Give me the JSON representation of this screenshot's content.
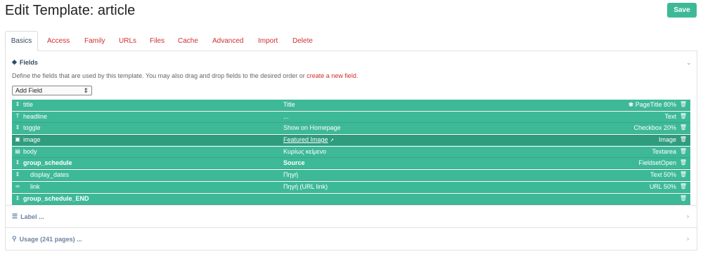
{
  "page_title": "Edit Template: article",
  "save_label": "Save",
  "tabs": [
    "Basics",
    "Access",
    "Family",
    "URLs",
    "Files",
    "Cache",
    "Advanced",
    "Import",
    "Delete"
  ],
  "fields_section": {
    "title": "Fields",
    "description": "Define the fields that are used by this template. You may also drag and drop fields to the desired order or",
    "link_text": "create a new field.",
    "add_field_select": "Add Field"
  },
  "rows": [
    {
      "icon": "⇕",
      "name": "title",
      "label": "Title",
      "type": "✱ PageTitle 80%"
    },
    {
      "icon": "T",
      "name": "headline",
      "label": "...",
      "type": "Text"
    },
    {
      "icon": "⇕",
      "name": "toggle",
      "label": "Show on Homepage",
      "type": "Checkbox 20%"
    },
    {
      "icon": "▣",
      "name": "image",
      "label": "Featured Image",
      "label_suffix": "↗",
      "type": "Image"
    },
    {
      "icon": "▤",
      "name": "body",
      "label": "Κυρίως κείμενο",
      "type": "Textarea"
    },
    {
      "icon": "⇕",
      "name": "group_schedule",
      "label": "Source",
      "type": "FieldsetOpen"
    },
    {
      "icon": "⇕",
      "name": "display_dates",
      "label": "Πηγή",
      "type": "Text 50%"
    },
    {
      "icon": "∞",
      "name": "link",
      "label": "Πηγή (URL link)",
      "type": "URL 50%"
    },
    {
      "icon": "⇕",
      "name": "group_schedule_END",
      "label": "",
      "type": ""
    }
  ],
  "collapsed_sections": [
    "Label ...",
    "Usage (241 pages) ..."
  ],
  "colors": {
    "accent": "#3eb998",
    "link": "#d02f2f",
    "text": "#354b60"
  }
}
